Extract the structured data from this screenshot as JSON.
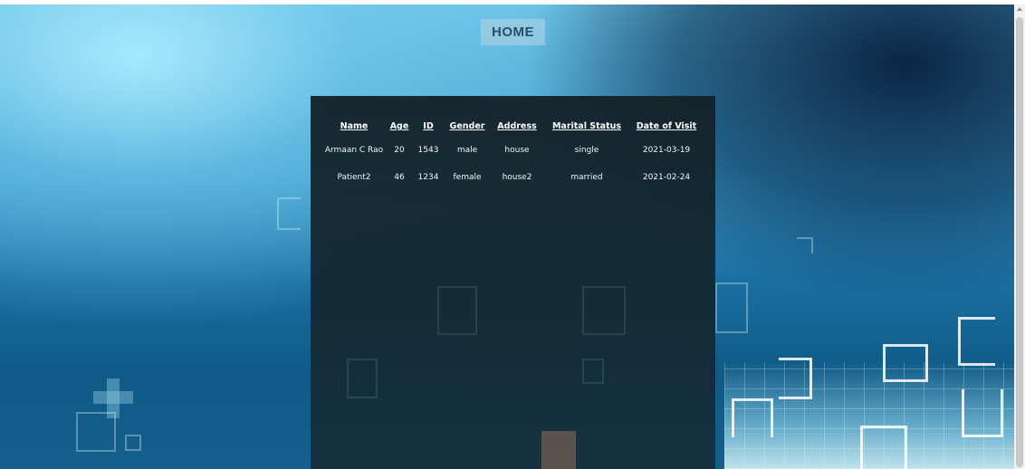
{
  "nav": {
    "home_label": "HOME"
  },
  "table": {
    "headers": [
      "Name",
      "Age",
      "ID",
      "Gender",
      "Address",
      "Marital Status",
      "Date of Visit"
    ],
    "rows": [
      [
        "Armaan C Rao",
        "20",
        "1543",
        "male",
        "house",
        "single",
        "2021-03-19"
      ],
      [
        "Patient2",
        "46",
        "1234",
        "female",
        "house2",
        "married",
        "2021-02-24"
      ]
    ]
  },
  "colors": {
    "panel": "#142228",
    "home_button_bg": "#a0cde1",
    "home_button_text": "#28506a"
  }
}
